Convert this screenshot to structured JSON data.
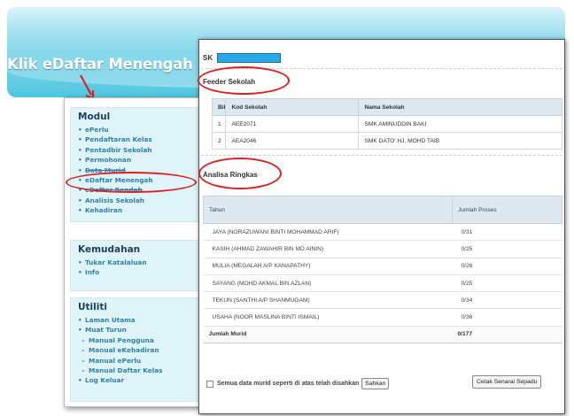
{
  "callout": "Klik eDaftar Menengah",
  "menu": {
    "modul": {
      "title": "Modul",
      "items": [
        "ePerlu",
        "Pendaftaran Kelas",
        "Pentadbir Sekolah",
        "Permohonan",
        "Data Murid",
        "eDaftar Menengah",
        "eDaftar Rendah",
        "Analisis Sekolah",
        "Kehadiran"
      ]
    },
    "kemudahan": {
      "title": "Kemudahan",
      "items": [
        "Tukar Katalaluan",
        "Info"
      ]
    },
    "utiliti": {
      "title": "Utiliti",
      "items": [
        "Laman Utama",
        "Muat Turun"
      ],
      "subitems": [
        "Manual Pengguna",
        "Manual eKehadiran",
        "Manual ePerlu",
        "Manual Daftar Kelas"
      ],
      "last": "Log Keluar"
    }
  },
  "main": {
    "sk_label": "SK",
    "feeder": {
      "heading": "Feeder Sekolah",
      "headers": [
        "Bil",
        "Kod Sekolah",
        "Nama Sekolah"
      ],
      "rows": [
        [
          "1",
          "AEE2071",
          "SMK AMINUDDIN BAKI"
        ],
        [
          "2",
          "AEA2046",
          "SMK DATO' HJ. MOHD TAIB"
        ]
      ]
    },
    "analisa": {
      "heading": "Analisa Ringkas",
      "headers": [
        "Tahun",
        "Jumlah Proses"
      ],
      "rows": [
        [
          "JAYA (NORAZUWANI BINTI MOHAMMAD ARIF)",
          "0/31"
        ],
        [
          "KASIH (AHMAD ZAWAHIR BIN MD AININ)",
          "0/25"
        ],
        [
          "MULIA (MEGALAH A/P KANAPATHY)",
          "0/26"
        ],
        [
          "SAYANG (MOHD AKMAL BIN AZLAN)",
          "0/25"
        ],
        [
          "TEKUN (SANTHI A/P SHANMUGAM)",
          "0/34"
        ],
        [
          "USAHA (NOOR MASLINA BINTI ISMAIL)",
          "0/36"
        ]
      ],
      "total_label": "Jumlah Murid",
      "total_value": "0/177"
    },
    "confirm_text": "Semua data murid seperti di atas telah disahkan",
    "confirm_button": "Sahkan",
    "print_button": "Cetak Senarai Sepadu"
  }
}
